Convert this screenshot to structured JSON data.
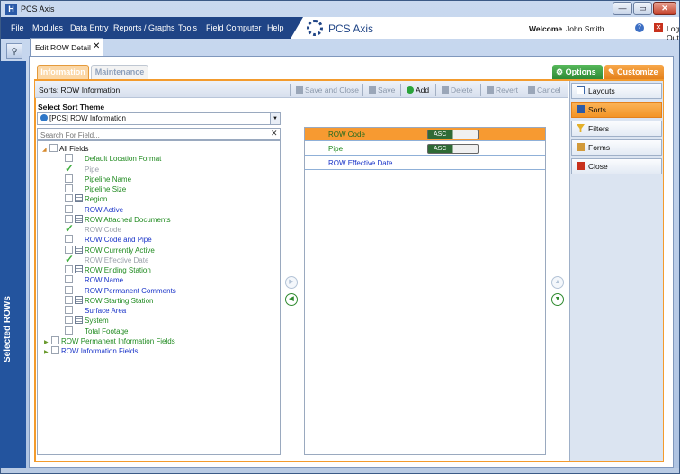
{
  "window": {
    "title": "PCS Axis",
    "minimize": "—",
    "restore": "▭",
    "close": "✕",
    "app_icon": "H"
  },
  "menu": {
    "items": [
      "File",
      "Modules",
      "Data Entry",
      "Reports / Graphs",
      "Tools",
      "Field Computer",
      "Help"
    ]
  },
  "brand": {
    "name": "PCS Axis"
  },
  "user": {
    "welcome": "Welcome",
    "name": "John Smith",
    "logout": "Log Out"
  },
  "sidebar": {
    "label": "Selected ROWs",
    "search_icon": "⚲"
  },
  "doc_tab": {
    "label": "Edit ROW Detail",
    "close": "✕"
  },
  "tabs": {
    "information": "Information",
    "maintenance": "Maintenance",
    "options": "Options",
    "customize": "Customize"
  },
  "toolbar": {
    "title": "Sorts:  ROW Information",
    "save_close": "Save and Close",
    "save": "Save",
    "add": "Add",
    "delete": "Delete",
    "revert": "Revert",
    "cancel": "Cancel"
  },
  "theme": {
    "label": "Select Sort Theme",
    "value": "[PCS] ROW Information"
  },
  "field_search": {
    "placeholder": "Search For Field..."
  },
  "tree": {
    "root": "All Fields",
    "items": [
      {
        "label": "Default Location Format",
        "mark": "cb",
        "color": "green"
      },
      {
        "label": "Pipe",
        "mark": "chk",
        "color": "gray"
      },
      {
        "label": "Pipeline Name",
        "mark": "cb",
        "color": "green"
      },
      {
        "label": "Pipeline Size",
        "mark": "cb",
        "color": "green"
      },
      {
        "label": "Region",
        "mark": "grid",
        "color": "green"
      },
      {
        "label": "ROW Active",
        "mark": "cb",
        "color": "blue"
      },
      {
        "label": "ROW Attached Documents",
        "mark": "grid",
        "color": "green"
      },
      {
        "label": "ROW Code",
        "mark": "chk",
        "color": "gray"
      },
      {
        "label": "ROW Code and Pipe",
        "mark": "cb",
        "color": "blue"
      },
      {
        "label": "ROW Currently Active",
        "mark": "grid",
        "color": "green"
      },
      {
        "label": "ROW Effective Date",
        "mark": "chk",
        "color": "gray"
      },
      {
        "label": "ROW Ending Station",
        "mark": "grid",
        "color": "green"
      },
      {
        "label": "ROW Name",
        "mark": "cb",
        "color": "blue"
      },
      {
        "label": "ROW Permanent Comments",
        "mark": "cb",
        "color": "blue"
      },
      {
        "label": "ROW Starting Station",
        "mark": "grid",
        "color": "green"
      },
      {
        "label": "Surface Area",
        "mark": "cb",
        "color": "blue"
      },
      {
        "label": "System",
        "mark": "grid",
        "color": "green"
      },
      {
        "label": "Total Footage",
        "mark": "cb",
        "color": "green"
      }
    ],
    "groups": [
      {
        "label": "ROW Permanent Information Fields",
        "color": "green"
      },
      {
        "label": "ROW Information Fields",
        "color": "blue"
      }
    ]
  },
  "sorts": [
    {
      "field": "ROW Code",
      "order": "ASC",
      "selected": true,
      "color": "green"
    },
    {
      "field": "Pipe",
      "order": "ASC",
      "selected": false,
      "color": "green"
    },
    {
      "field": "ROW Effective Date",
      "order": "",
      "selected": false,
      "color": "blue"
    }
  ],
  "arrows": {
    "right": "▶",
    "left": "◀",
    "up": "▲",
    "down": "▼"
  },
  "nav": {
    "layouts": "Layouts",
    "sorts": "Sorts",
    "filters": "Filters",
    "forms": "Forms",
    "close": "Close"
  },
  "colors": {
    "accent_orange": "#f39b2d",
    "menu_blue": "#1f4486",
    "green": "#1f8a1f",
    "blue": "#1a34c8"
  }
}
